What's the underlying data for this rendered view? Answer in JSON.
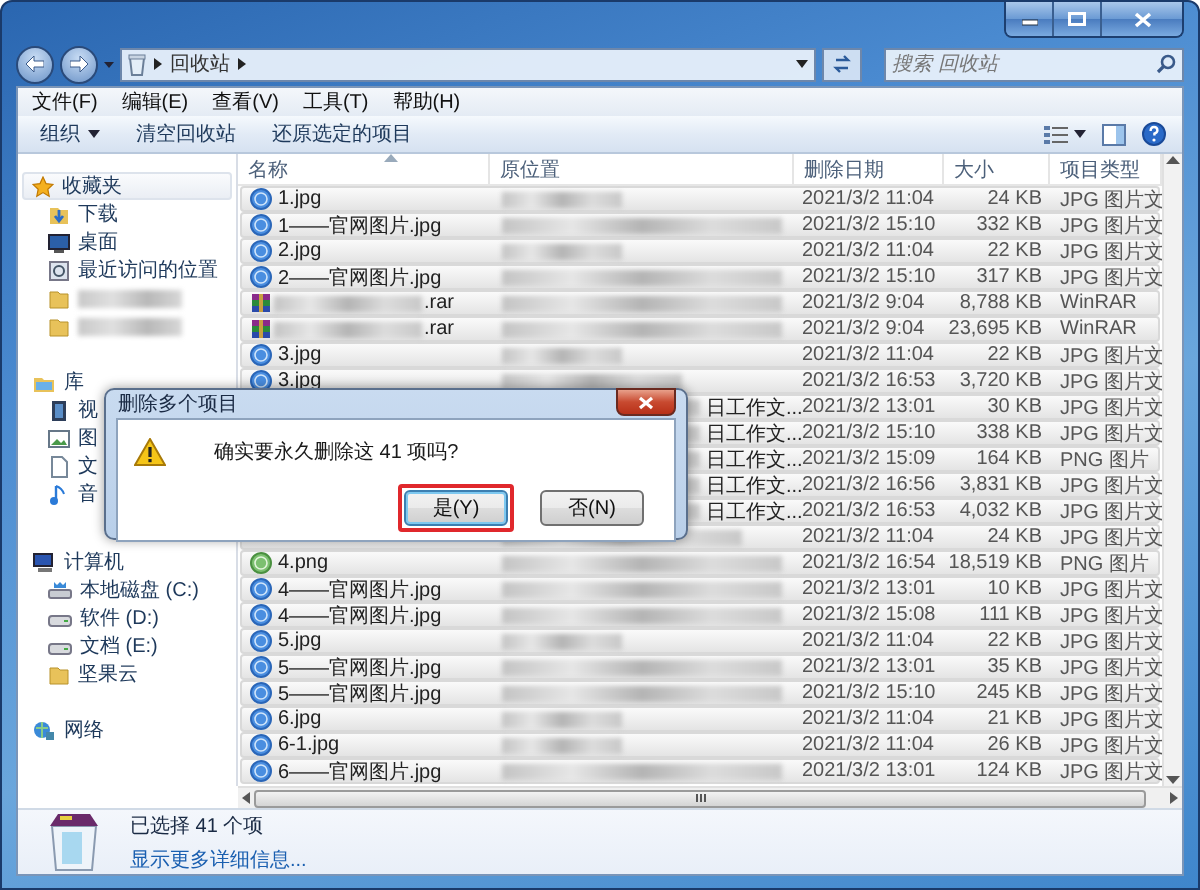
{
  "address_bar": {
    "path": [
      "回收站"
    ],
    "search_placeholder": "搜索 回收站"
  },
  "menu": [
    "文件(F)",
    "编辑(E)",
    "查看(V)",
    "工具(T)",
    "帮助(H)"
  ],
  "toolbar": [
    {
      "label": "组织",
      "kind": "menu"
    },
    {
      "label": "清空回收站",
      "kind": "plain"
    },
    {
      "label": "还原选定的项目",
      "kind": "plain"
    }
  ],
  "nav_pane": [
    {
      "label": "收藏夹",
      "kind": "star",
      "selected": true,
      "children": [
        {
          "label": "下载",
          "kind": "download",
          "selected": false
        },
        {
          "label": "桌面",
          "kind": "desktop",
          "selected": false
        },
        {
          "label": "最近访问的位置",
          "kind": "recent",
          "selected": false
        },
        {
          "kind": "folder",
          "selected": false
        },
        {
          "kind": "folder",
          "selected": false
        }
      ]
    },
    {
      "label": "库",
      "kind": "library",
      "selected": false,
      "children": [
        {
          "label": "视",
          "kind": "video",
          "selected": false
        },
        {
          "label": "图",
          "kind": "picture",
          "selected": false
        },
        {
          "label": "文",
          "kind": "document",
          "selected": false
        },
        {
          "label": "音",
          "kind": "music",
          "selected": false
        }
      ]
    },
    {
      "label": "计算机",
      "kind": "computer",
      "selected": false,
      "children": [
        {
          "label": "本地磁盘 (C:)",
          "kind": "system-drive",
          "selected": false
        },
        {
          "label": "软件 (D:)",
          "kind": "drive",
          "selected": false
        },
        {
          "label": "文档 (E:)",
          "kind": "drive",
          "selected": false
        },
        {
          "label": "坚果云",
          "kind": "folder",
          "selected": false
        }
      ]
    },
    {
      "label": "网络",
      "kind": "network",
      "selected": false
    }
  ],
  "columns": [
    {
      "label": "名称",
      "sorted": true
    },
    {
      "label": "原位置",
      "sorted": false
    },
    {
      "label": "删除日期",
      "sorted": false
    },
    {
      "label": "大小",
      "sorted": false
    },
    {
      "label": "项目类型",
      "sorted": false
    }
  ],
  "rows": [
    {
      "name": "1.jpg",
      "kind": "jpg",
      "date": "2021/3/2 11:04",
      "size": "24 KB",
      "type": "JPG 图片文",
      "selected": true
    },
    {
      "name": "1——官网图片.jpg",
      "kind": "jpg",
      "date": "2021/3/2 15:10",
      "size": "332 KB",
      "type": "JPG 图片文",
      "selected": true
    },
    {
      "name": "2.jpg",
      "kind": "jpg",
      "date": "2021/3/2 11:04",
      "size": "22 KB",
      "type": "JPG 图片文",
      "selected": true
    },
    {
      "name": "2——官网图片.jpg",
      "kind": "jpg",
      "date": "2021/3/2 15:10",
      "size": "317 KB",
      "type": "JPG 图片文",
      "selected": true
    },
    {
      "name": ".rar",
      "kind": "rar",
      "date": "2021/3/2 9:04",
      "size": "8,788 KB",
      "type": "WinRAR",
      "selected": true
    },
    {
      "name": ".rar",
      "kind": "rar",
      "date": "2021/3/2 9:04",
      "size": "23,695 KB",
      "type": "WinRAR",
      "selected": true
    },
    {
      "name": "3.jpg",
      "kind": "jpg",
      "date": "2021/3/2 11:04",
      "size": "22 KB",
      "type": "JPG 图片文",
      "selected": true
    },
    {
      "name": "3.jpg",
      "kind": "jpg",
      "date": "2021/3/2 16:53",
      "size": "3,720 KB",
      "type": "JPG 图片文",
      "selected": true
    },
    {
      "location": "日工作文...",
      "date": "2021/3/2 13:01",
      "size": "30 KB",
      "type": "JPG 图片文",
      "selected": true
    },
    {
      "location": "日工作文...",
      "date": "2021/3/2 15:10",
      "size": "338 KB",
      "type": "JPG 图片文",
      "selected": true
    },
    {
      "location": "日工作文...",
      "date": "2021/3/2 15:09",
      "size": "164 KB",
      "type": "PNG 图片",
      "selected": true
    },
    {
      "location": "日工作文...",
      "date": "2021/3/2 16:56",
      "size": "3,831 KB",
      "type": "JPG 图片文",
      "selected": true
    },
    {
      "location": "日工作文...",
      "date": "2021/3/2 16:53",
      "size": "4,032 KB",
      "type": "JPG 图片文",
      "selected": true
    },
    {
      "date": "2021/3/2 11:04",
      "size": "24 KB",
      "type": "JPG 图片文",
      "selected": true
    },
    {
      "name": "4.png",
      "kind": "png",
      "date": "2021/3/2 16:54",
      "size": "18,519 KB",
      "type": "PNG 图片",
      "selected": true
    },
    {
      "name": "4——官网图片.jpg",
      "kind": "jpg",
      "date": "2021/3/2 13:01",
      "size": "10 KB",
      "type": "JPG 图片文",
      "selected": true
    },
    {
      "name": "4——官网图片.jpg",
      "kind": "jpg",
      "date": "2021/3/2 15:08",
      "size": "111 KB",
      "type": "JPG 图片文",
      "selected": true
    },
    {
      "name": "5.jpg",
      "kind": "jpg",
      "date": "2021/3/2 11:04",
      "size": "22 KB",
      "type": "JPG 图片文",
      "selected": true
    },
    {
      "name": "5——官网图片.jpg",
      "kind": "jpg",
      "date": "2021/3/2 13:01",
      "size": "35 KB",
      "type": "JPG 图片文",
      "selected": true
    },
    {
      "name": "5——官网图片.jpg",
      "kind": "jpg",
      "date": "2021/3/2 15:10",
      "size": "245 KB",
      "type": "JPG 图片文",
      "selected": true
    },
    {
      "name": "6.jpg",
      "kind": "jpg",
      "date": "2021/3/2 11:04",
      "size": "21 KB",
      "type": "JPG 图片文",
      "selected": true
    },
    {
      "name": "6-1.jpg",
      "kind": "jpg",
      "date": "2021/3/2 11:04",
      "size": "26 KB",
      "type": "JPG 图片文",
      "selected": true
    },
    {
      "name": "6——官网图片.jpg",
      "kind": "jpg",
      "date": "2021/3/2 13:01",
      "size": "124 KB",
      "type": "JPG 图片文",
      "selected": true
    }
  ],
  "status": {
    "selection": "已选择 41 个项",
    "details_link": "显示更多详细信息..."
  },
  "dialog": {
    "title": "删除多个项目",
    "message": "确实要永久删除这 41 项吗?",
    "buttons": [
      {
        "label": "是(Y)",
        "default": true,
        "highlighted": true
      },
      {
        "label": "否(N)",
        "default": false,
        "highlighted": false
      }
    ]
  }
}
